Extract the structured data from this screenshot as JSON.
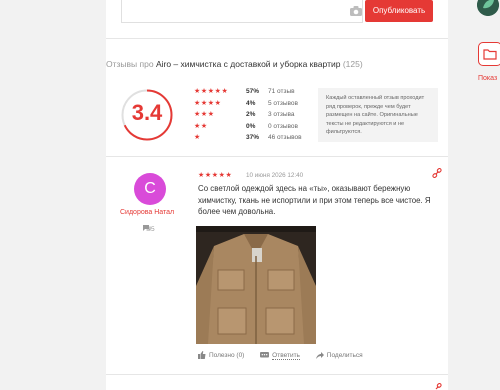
{
  "composer": {
    "publish_label": "Опубликовать"
  },
  "reviews_header": {
    "prefix": "Отзывы про",
    "brand": "Airo – химчистка с доставкой и уборка квартир",
    "count": "(125)"
  },
  "rating": {
    "score": "3.4",
    "score_value": 3.4,
    "distribution": [
      {
        "stars": "★★★★★",
        "pct": "57%",
        "count": "71 отзыв"
      },
      {
        "stars": "★★★★",
        "pct": "4%",
        "count": "5 отзывов"
      },
      {
        "stars": "★★★",
        "pct": "2%",
        "count": "3 отзыва"
      },
      {
        "stars": "★★",
        "pct": "0%",
        "count": "0 отзывов"
      },
      {
        "stars": "★",
        "pct": "37%",
        "count": "46 отзывов"
      }
    ],
    "note": "Каждый оставленный отзыв проходит ряд проверок, прежде чем будет размещен на сайте. Оригинальные тексты не редактируются и не фильтруются."
  },
  "review": {
    "avatar_letter": "С",
    "author": "Сидорова Натал",
    "author_reviews": "5",
    "stars": "★★★★★",
    "date": "10 июня 2026 12:40",
    "text": "Со светлой одеждой здесь на «ты», оказывают бережную химчистку, ткань не испортили и при этом теперь все чистое. Я более чем довольна.",
    "actions": {
      "useful": "Полезно (0)",
      "reply": "Ответить",
      "share": "Поделиться"
    }
  },
  "sidebar": {
    "show_label": "Показ"
  },
  "colors": {
    "accent": "#e53935",
    "avatar": "#d94bd9"
  }
}
